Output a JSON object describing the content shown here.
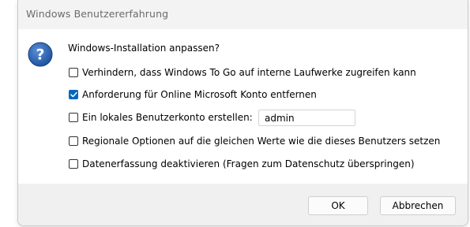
{
  "window": {
    "title": "Windows Benutzererfahrung"
  },
  "dialog": {
    "icon": "question-icon",
    "prompt": "Windows-Installation anpassen?",
    "options": [
      {
        "label": "Verhindern, dass Windows To Go auf interne Laufwerke zugreifen kann",
        "checked": false
      },
      {
        "label": "Anforderung für Online Microsoft Konto entfernen",
        "checked": true
      },
      {
        "label": "Ein lokales Benutzerkonto erstellen:",
        "checked": false
      },
      {
        "label": "Regionale Optionen auf die gleichen Werte wie die dieses Benutzers setzen",
        "checked": false
      },
      {
        "label": "Datenerfassung deaktivieren (Fragen zum Datenschutz überspringen)",
        "checked": false
      }
    ],
    "username_value": "admin"
  },
  "buttons": {
    "ok_label": "OK",
    "cancel_label": "Abbrechen"
  },
  "colors": {
    "accent": "#0067c0",
    "icon_blue": "#1f5fae"
  }
}
